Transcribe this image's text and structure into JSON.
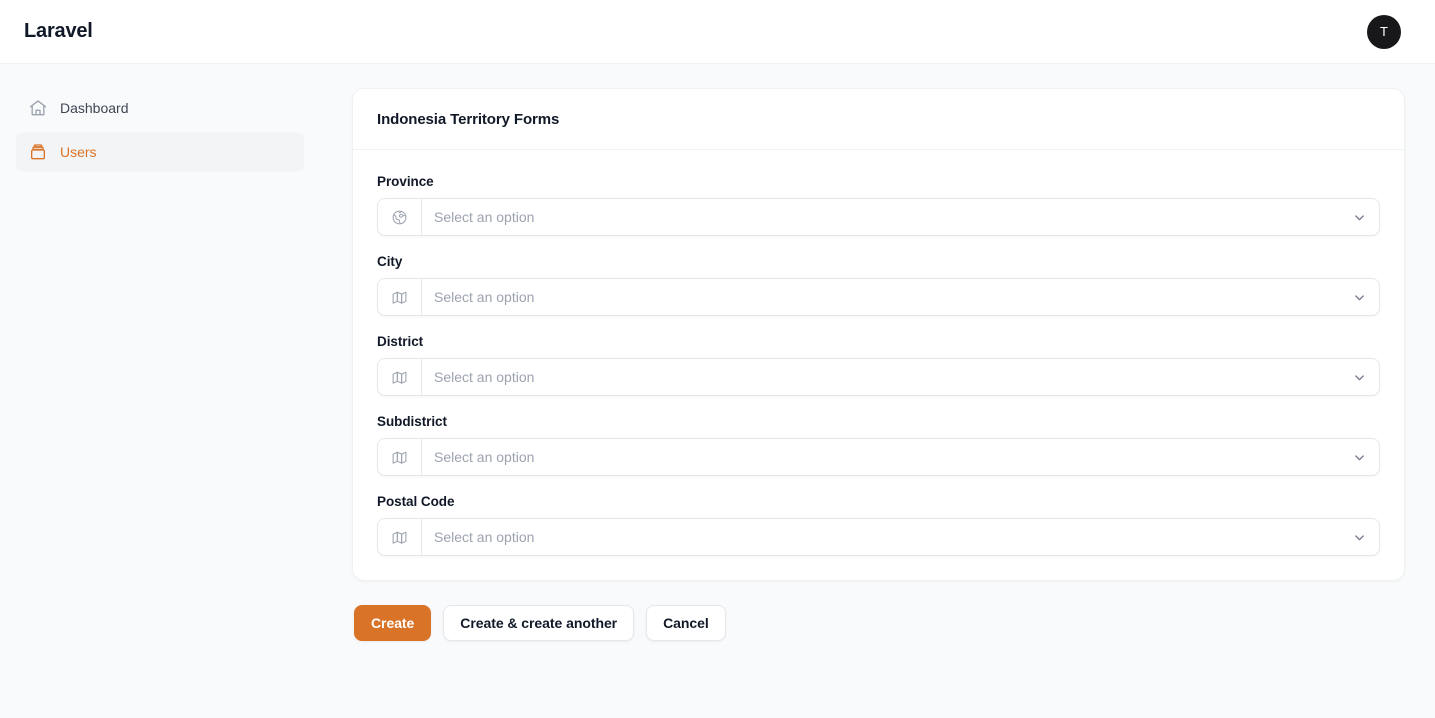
{
  "topbar": {
    "brand": "Laravel",
    "avatar_initial": "T"
  },
  "sidebar": {
    "items": [
      {
        "label": "Dashboard",
        "icon": "home-icon",
        "active": false
      },
      {
        "label": "Users",
        "icon": "archive-box-icon",
        "active": true
      }
    ]
  },
  "card": {
    "title": "Indonesia Territory Forms",
    "fields": [
      {
        "label": "Province",
        "placeholder": "Select an option",
        "icon": "globe-icon"
      },
      {
        "label": "City",
        "placeholder": "Select an option",
        "icon": "map-icon"
      },
      {
        "label": "District",
        "placeholder": "Select an option",
        "icon": "map-icon"
      },
      {
        "label": "Subdistrict",
        "placeholder": "Select an option",
        "icon": "map-icon"
      },
      {
        "label": "Postal Code",
        "placeholder": "Select an option",
        "icon": "map-icon"
      }
    ]
  },
  "actions": {
    "create": "Create",
    "create_another": "Create & create another",
    "cancel": "Cancel"
  },
  "colors": {
    "accent": "#d97327",
    "page_bg": "#f9fafb",
    "surface": "#ffffff",
    "border": "#e5e7eb",
    "text": "#111827",
    "muted": "#9ca3af",
    "avatar_bg": "#18181b"
  }
}
